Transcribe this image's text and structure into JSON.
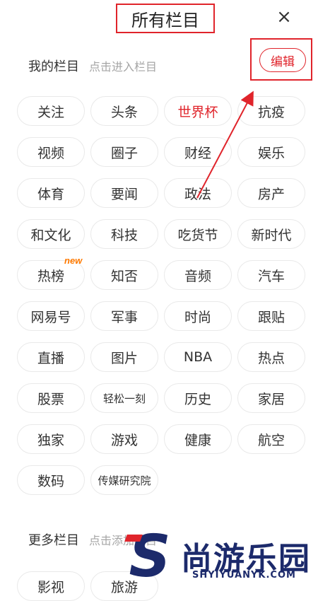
{
  "header": {
    "title": "所有栏目",
    "close_icon": "×"
  },
  "my_columns": {
    "title": "我的栏目",
    "hint": "点击进入栏目",
    "edit_label": "编辑",
    "items": [
      {
        "label": "关注"
      },
      {
        "label": "头条"
      },
      {
        "label": "世界杯",
        "active": true
      },
      {
        "label": "抗疫"
      },
      {
        "label": "视频"
      },
      {
        "label": "圈子"
      },
      {
        "label": "财经"
      },
      {
        "label": "娱乐"
      },
      {
        "label": "体育"
      },
      {
        "label": "要闻"
      },
      {
        "label": "政法"
      },
      {
        "label": "房产"
      },
      {
        "label": "和文化"
      },
      {
        "label": "科技"
      },
      {
        "label": "吃货节"
      },
      {
        "label": "新时代"
      },
      {
        "label": "热榜",
        "badge": "new"
      },
      {
        "label": "知否"
      },
      {
        "label": "音频"
      },
      {
        "label": "汽车"
      },
      {
        "label": "网易号"
      },
      {
        "label": "军事"
      },
      {
        "label": "时尚"
      },
      {
        "label": "跟贴"
      },
      {
        "label": "直播"
      },
      {
        "label": "图片"
      },
      {
        "label": "NBA"
      },
      {
        "label": "热点"
      },
      {
        "label": "股票"
      },
      {
        "label": "轻松一刻",
        "small": true
      },
      {
        "label": "历史"
      },
      {
        "label": "家居"
      },
      {
        "label": "独家"
      },
      {
        "label": "游戏"
      },
      {
        "label": "健康"
      },
      {
        "label": "航空"
      },
      {
        "label": "数码"
      },
      {
        "label": "传媒研究院",
        "small": true
      }
    ]
  },
  "more_columns": {
    "title": "更多栏目",
    "hint": "点击添加栏目",
    "items": [
      {
        "label": "影视"
      },
      {
        "label": "旅游"
      }
    ]
  },
  "watermark": {
    "brand": "尚游乐园",
    "url": "SHYIYUANYK.COM",
    "letter": "S"
  },
  "colors": {
    "accent": "#e0242b",
    "badge": "#ff7a00",
    "watermark": "#1c2a6b"
  }
}
